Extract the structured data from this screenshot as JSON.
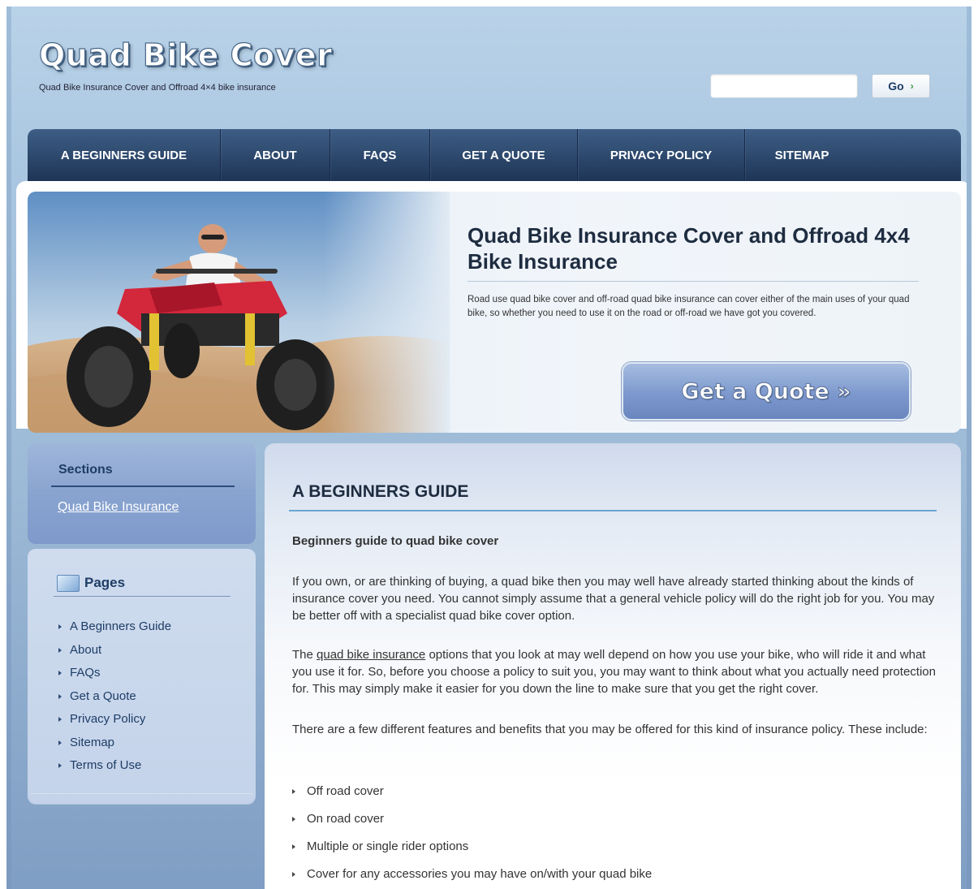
{
  "header": {
    "logo": "Quad Bike Cover",
    "tagline": "Quad Bike Insurance Cover and Offroad 4×4 bike insurance",
    "search_value": "",
    "search_button": "Go",
    "search_button_icon": "chevron-right-icon"
  },
  "nav": {
    "items": [
      "A BEGINNERS GUIDE",
      "ABOUT",
      "FAQS",
      "GET A QUOTE",
      "PRIVACY POLICY",
      "SITEMAP"
    ]
  },
  "hero": {
    "title": "Quad Bike Insurance Cover and Offroad 4x4 Bike Insurance",
    "text": "Road use quad bike cover and off-road quad bike insurance can cover either of the main uses of your quad bike, so whether you need to use it on the road or off-road we have got you covered.",
    "cta": "Get a Quote »"
  },
  "sidebar": {
    "sections_title": "Sections",
    "sections_link": "Quad Bike Insurance",
    "pages_title": "Pages",
    "pages_icon": "folder-icon",
    "pages": [
      "A Beginners Guide",
      "About",
      "FAQs",
      "Get a Quote",
      "Privacy Policy",
      "Sitemap",
      "Terms of Use"
    ]
  },
  "main": {
    "title": "A BEGINNERS GUIDE",
    "subtitle": "Beginners guide to quad bike cover",
    "para1": "If you own, or are thinking of buying, a quad bike then you may well have already started thinking about the kinds of insurance cover you need. You cannot simply assume that a general vehicle policy will do the right job for you. You may be better off with a specialist quad bike cover option.",
    "para2_before": "The ",
    "para2_link": "quad bike insurance",
    "para2_after": " options that you look at may well depend on how you use your bike, who will ride it and what you use it for. So, before you choose a policy to suit you, you may want to think about what you actually need protection for. This may simply make it easier for you down the line to make sure that you get the right cover.",
    "para3": "There are a few different features and benefits that you may be offered for this kind of insurance policy. These include:",
    "features": [
      "Off road cover",
      "On road cover",
      "Multiple or single rider options",
      "Cover for any accessories you may have on/with your quad bike"
    ]
  }
}
